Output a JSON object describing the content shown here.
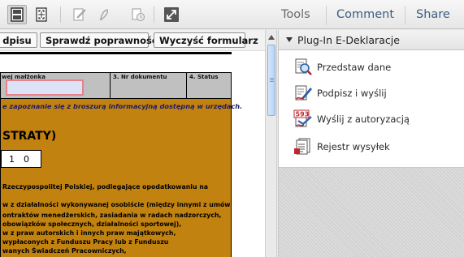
{
  "toolbar": {
    "icons": [
      "page-layout-icon",
      "fit-page-icon",
      "edit-sign-icon",
      "pen-sign-icon",
      "timestamp-sign-icon",
      "expand-icon"
    ],
    "tabs": {
      "tools": "Tools",
      "comment": "Comment",
      "share": "Share"
    }
  },
  "form_toolbar": {
    "sign_partial": "dpisu",
    "verify": "Sprawdź poprawność",
    "clear": "Wyczyść formularz"
  },
  "document": {
    "header": {
      "spouse_label": "wej małżonka",
      "doc_number_label": "3. Nr dokumentu",
      "status_label": "4. Status"
    },
    "note": "e zapoznanie się z broszurą informacyjną dostępną w urzędach.",
    "section_title": "STRATY)",
    "digits": [
      "1",
      "0"
    ],
    "lines": [
      "Rzeczypospolitej Polskiej, podlegające opodatkowaniu na",
      "w z działalności wykonywanej osobiście (między innymi z umów",
      "ontraktów menedżerskich, zasiadania w radach nadzorczych,",
      "obowiązków społecznych, działalności sportowej),",
      "w z praw autorskich i innych praw majątkowych,",
      " wypłaconych z Funduszu Pracy lub z Funduszu",
      "wanych Świadczeń Pracowniczych,"
    ]
  },
  "panel": {
    "title": "Plug-In E-Deklaracje",
    "items": [
      {
        "label": "Przedstaw dane",
        "icon": "magnifier-document-icon"
      },
      {
        "label": "Podpisz i wyślij",
        "icon": "sign-send-icon"
      },
      {
        "label": "Wyślij z autoryzacją",
        "icon": "authorized-send-icon"
      },
      {
        "label": "Rejestr wysyłek",
        "icon": "send-register-icon"
      }
    ],
    "auth_badge": "593"
  },
  "colors": {
    "form_background": "#c2820f",
    "field_highlight": "#dde3f7",
    "field_border": "#e8828a",
    "tab_text": "#3d5d7e"
  }
}
